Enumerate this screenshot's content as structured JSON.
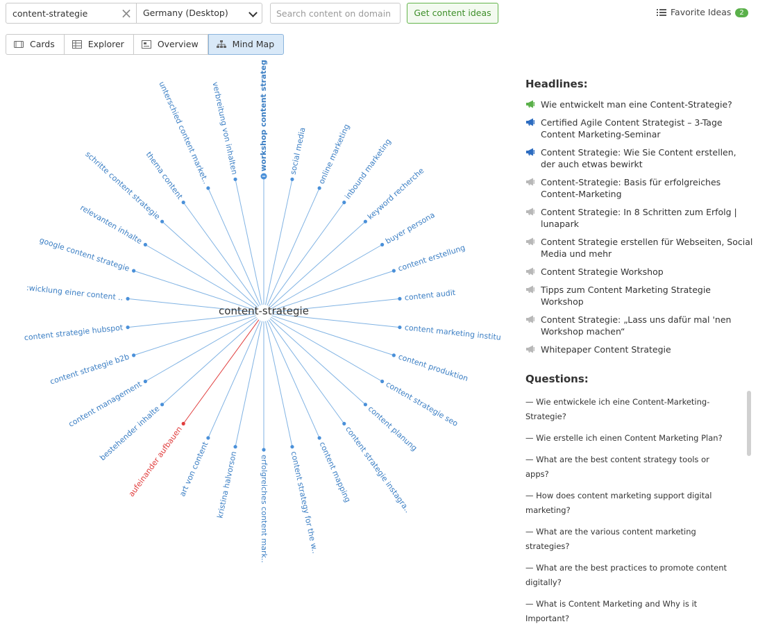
{
  "search": {
    "value": "content-strategie",
    "database": "Germany (Desktop)",
    "domain_placeholder": "Search content on domain",
    "submit_label": "Get content ideas"
  },
  "favorites": {
    "label": "Favorite Ideas",
    "count": "2"
  },
  "tabs": [
    {
      "label": "Cards",
      "icon": "cards-icon",
      "active": false
    },
    {
      "label": "Explorer",
      "icon": "table-icon",
      "active": false
    },
    {
      "label": "Overview",
      "icon": "overview-icon",
      "active": false
    },
    {
      "label": "Mind Map",
      "icon": "mindmap-icon",
      "active": true
    }
  ],
  "mindmap": {
    "center": "content-strategie",
    "nodes": [
      {
        "label": "workshop content strategie",
        "selected": true
      },
      {
        "label": "social media"
      },
      {
        "label": "online marketing"
      },
      {
        "label": "inbound marketing"
      },
      {
        "label": "keyword recherche"
      },
      {
        "label": "buyer persona"
      },
      {
        "label": "content erstellung"
      },
      {
        "label": "content audit"
      },
      {
        "label": "content marketing institu"
      },
      {
        "label": "content produktion"
      },
      {
        "label": "content strategie seo"
      },
      {
        "label": "content planung"
      },
      {
        "label": "content strategie instagra.."
      },
      {
        "label": "content mapping"
      },
      {
        "label": "content strategy for the w.."
      },
      {
        "label": "erfolgreiches content mark.."
      },
      {
        "label": "kristina halvorson"
      },
      {
        "label": "art von content"
      },
      {
        "label": "aufeinander aufbauen",
        "highlight": true
      },
      {
        "label": "bestehender inhalte"
      },
      {
        "label": "content management"
      },
      {
        "label": "content strategie b2b"
      },
      {
        "label": "content strategie hubspot"
      },
      {
        "label": ":wicklung einer content .."
      },
      {
        "label": "google content strategie"
      },
      {
        "label": "relevanten inhalte"
      },
      {
        "label": "schritte content strategie"
      },
      {
        "label": "thema content"
      },
      {
        "label": "unterschied content market.."
      },
      {
        "label": "verbreitung von inhalten"
      }
    ]
  },
  "headlines": {
    "title": "Headlines:",
    "items": [
      {
        "text": "Wie entwickelt man eine Content-Strategie?",
        "icon": "megaphone-green-icon",
        "color": "#5ab04a"
      },
      {
        "text": "Certified Agile Content Strategist – 3-Tage Content Marketing-Seminar",
        "icon": "megaphone-blue-icon",
        "color": "#2d6cc0"
      },
      {
        "text": "Content Strategie: Wie Sie Content erstellen, der auch etwas bewirkt",
        "icon": "megaphone-blue-icon",
        "color": "#2d6cc0"
      },
      {
        "text": "Content-Strategie: Basis für erfolgreiches Content-Marketing",
        "icon": "megaphone-gray-icon",
        "color": "#b8b8b8"
      },
      {
        "text": "Content Strategie: In 8 Schritten zum Erfolg | lunapark",
        "icon": "megaphone-gray-icon",
        "color": "#b8b8b8"
      },
      {
        "text": "Content Strategie erstellen für Webseiten, Social Media und mehr",
        "icon": "megaphone-gray-icon",
        "color": "#b8b8b8"
      },
      {
        "text": "Content Strategie Workshop",
        "icon": "megaphone-gray-icon",
        "color": "#b8b8b8"
      },
      {
        "text": "Tipps zum Content Marketing Strategie Workshop",
        "icon": "megaphone-gray-icon",
        "color": "#b8b8b8"
      },
      {
        "text": "Content Strategie: „Lass uns dafür mal 'nen Workshop machen“",
        "icon": "megaphone-gray-icon",
        "color": "#b8b8b8"
      },
      {
        "text": "Whitepaper Content Strategie",
        "icon": "megaphone-gray-icon",
        "color": "#b8b8b8"
      }
    ]
  },
  "questions": {
    "title": "Questions:",
    "items": [
      "— Wie entwickele ich eine Content-Marketing-Strategie?",
      "— Wie erstelle ich einen Content Marketing Plan?",
      "— What are the best content strategy tools or apps?",
      "— How does content marketing support digital marketing?",
      "— What are the various content marketing strategies?",
      "— What are the best practices to promote content digitally?",
      "— What is Content Marketing and Why is it Important?"
    ]
  },
  "colors": {
    "node": "#4a90d9",
    "label": "#3c7fc4",
    "highlight": "#e03c3c",
    "line": "#7fb2e3"
  }
}
